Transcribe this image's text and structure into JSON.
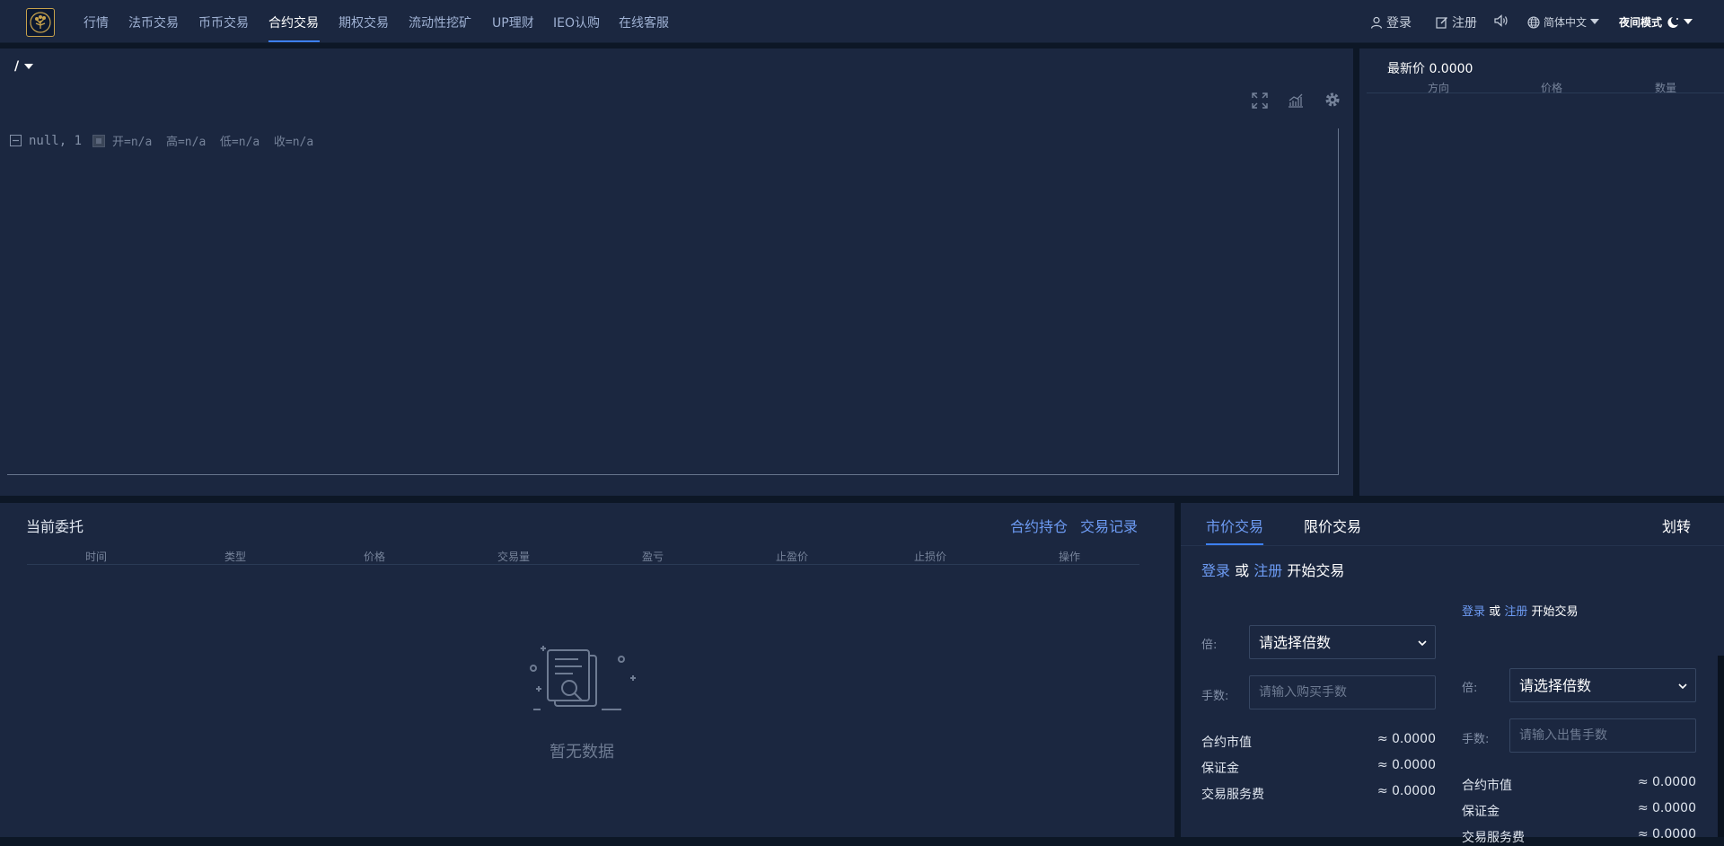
{
  "nav": {
    "items": [
      {
        "label": "行情"
      },
      {
        "label": "法币交易"
      },
      {
        "label": "币币交易"
      },
      {
        "label": "合约交易"
      },
      {
        "label": "期权交易"
      },
      {
        "label": "流动性挖矿"
      },
      {
        "label": "UP理财"
      },
      {
        "label": "IEO认购"
      },
      {
        "label": "在线客服"
      }
    ],
    "active_index": 3,
    "accent_color": "#3d7ff0"
  },
  "header_right": {
    "login": "登录",
    "register": "注册",
    "language": "简体中文",
    "night_mode": "夜间模式",
    "icons": [
      "user-icon",
      "edit-icon",
      "speaker-icon",
      "globe-icon",
      "moon-icon"
    ]
  },
  "chart_panel": {
    "symbol": "/",
    "legend_symbol": "null, 1",
    "ohlc": "开=n/a  高=n/a  低=n/a  收=n/a",
    "toolbar_icons": [
      "fullscreen-icon",
      "indicator-icon",
      "settings-icon"
    ]
  },
  "orderbook": {
    "latest_label": "最新价",
    "latest_value": "0.0000",
    "columns": [
      "方向",
      "价格",
      "数量"
    ]
  },
  "orders": {
    "title": "当前委托",
    "link_positions": "合约持仓",
    "link_records": "交易记录",
    "columns": [
      "时间",
      "类型",
      "价格",
      "交易量",
      "盈亏",
      "止盈价",
      "止损价",
      "操作"
    ],
    "empty_text": "暂无数据"
  },
  "trade": {
    "tab_market": "市价交易",
    "tab_limit": "限价交易",
    "transfer": "划转",
    "login": "登录",
    "or": "或",
    "register": "注册",
    "start": "开始交易",
    "buy": {
      "leverage_label": "倍:",
      "leverage_placeholder": "请选择倍数",
      "qty_label": "手数:",
      "qty_placeholder": "请输入购买手数",
      "rows": [
        {
          "label": "合约市值",
          "value": "≈ 0.0000"
        },
        {
          "label": "保证金",
          "value": "≈ 0.0000"
        },
        {
          "label": "交易服务费",
          "value": "≈ 0.0000"
        }
      ]
    },
    "sell": {
      "leverage_label": "倍:",
      "leverage_placeholder": "请选择倍数",
      "qty_label": "手数:",
      "qty_placeholder": "请输入出售手数",
      "rows": [
        {
          "label": "合约市值",
          "value": "≈ 0.0000"
        },
        {
          "label": "保证金",
          "value": "≈ 0.0000"
        },
        {
          "label": "交易服务费",
          "value": "≈ 0.0000"
        }
      ]
    }
  }
}
